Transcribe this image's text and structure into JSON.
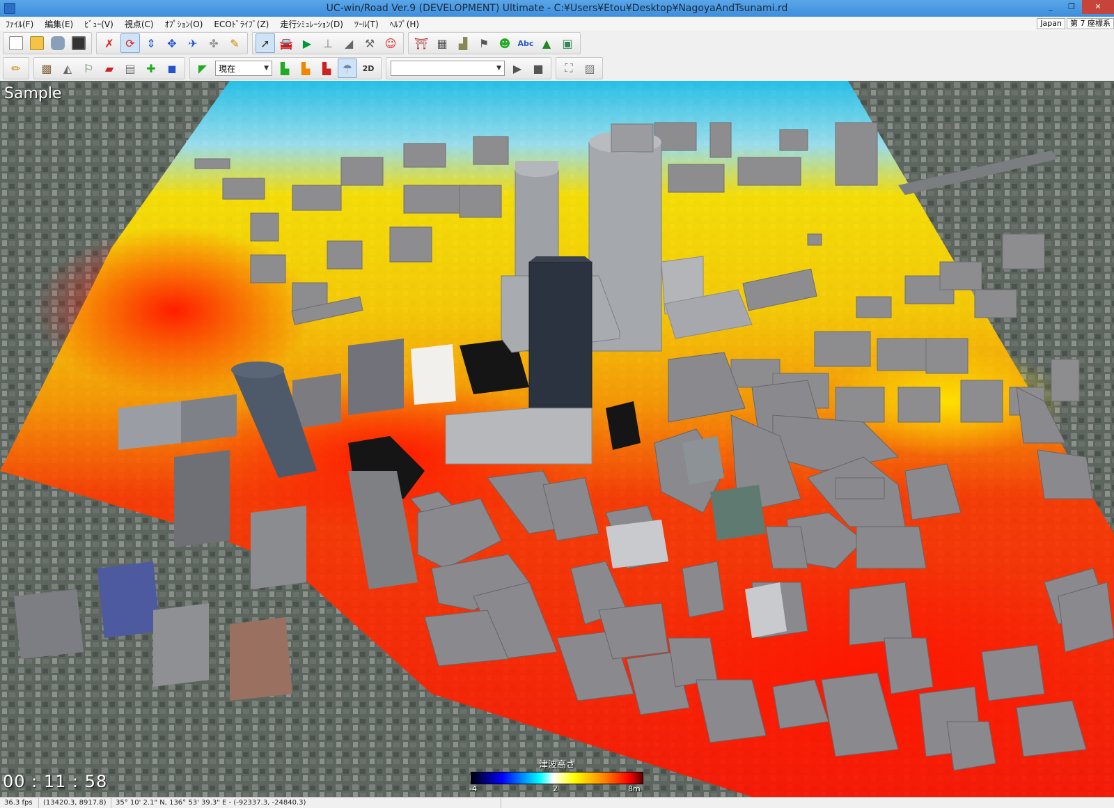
{
  "window": {
    "title": "UC-win/Road Ver.9 (DEVELOPMENT) Ultimate - C:¥Users¥Etou¥Desktop¥NagoyaAndTsunami.rd",
    "minimize": "_",
    "restore": "❐",
    "close": "✕"
  },
  "menu": {
    "items": [
      "ﾌｧｲﾙ(F)",
      "編集(E)",
      "ﾋﾞｭｰ(V)",
      "視点(C)",
      "ｵﾌﾟｼｮﾝ(O)",
      "ECOﾄﾞﾗｲﾌﾞ(Z)",
      "走行ｼﾐｭﾚｰｼｮﾝ(D)",
      "ﾂｰﾙ(T)",
      "ﾍﾙﾌﾟ(H)"
    ],
    "region": "Japan",
    "coord_system": "第 7 座標系"
  },
  "toolbar2": {
    "time_select": "現在",
    "view_2d": "2D",
    "empty_select": ""
  },
  "viewport": {
    "label": "Sample",
    "clock": "00 : 11 : 58"
  },
  "legend": {
    "title": "津波高さ",
    "ticks": [
      "-4",
      "2",
      "8m"
    ]
  },
  "status": {
    "fps": "36.3 fps",
    "local_coords": "(13420.3, 8917.8)",
    "geo_coords": "35°  10' 2.1\" N, 136°  53' 39.3\" E  -  (-92337.3, -24840.3)"
  },
  "colors": {
    "heat_red": "#ff1a00",
    "heat_yellow": "#ffe600",
    "heat_cyan": "#22c6f0",
    "building_gray": "#8d8d90"
  }
}
